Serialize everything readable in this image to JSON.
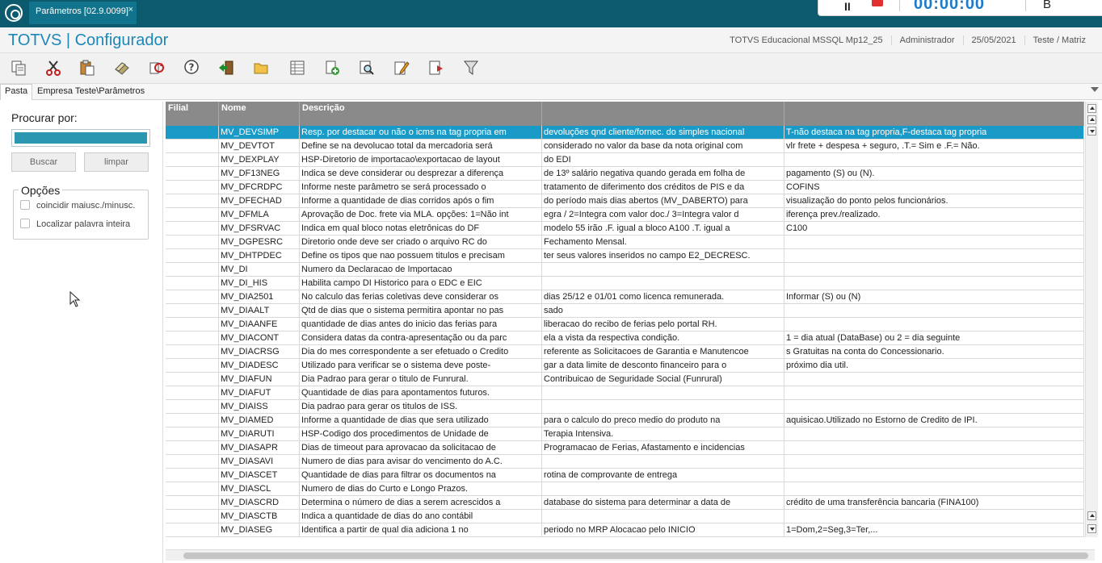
{
  "tab": {
    "title": "Parâmetros [02.9.0099]",
    "close": "×"
  },
  "timer": {
    "time": "00:00:00",
    "letter": "B",
    "pause": "II"
  },
  "app": {
    "title": "TOTVS | Configurador",
    "environment": "TOTVS Educacional MSSQL Mp12_25",
    "user": "Administrador",
    "date": "25/05/2021",
    "company": "Teste / Matriz"
  },
  "toolbar": {
    "icons": [
      "copy-icon",
      "cut-icon",
      "paste-icon",
      "erase-icon",
      "refresh-icon",
      "help-icon",
      "exit-icon",
      "folder-icon",
      "table-icon",
      "add-icon",
      "search-doc-icon",
      "edit-icon",
      "export-icon",
      "filter-icon"
    ]
  },
  "breadcrumb": {
    "tab": "Pasta",
    "path": "Empresa Teste\\Parâmetros"
  },
  "search": {
    "label": "Procurar por:",
    "value": "",
    "buscar": "Buscar",
    "limpar": "limpar",
    "options_title": "Opções",
    "opt_case": "coincidir maiusc./minusc.",
    "opt_word": "Localizar palavra inteira"
  },
  "grid": {
    "headers": [
      "Filial",
      "Nome",
      "Descrição",
      "",
      ""
    ],
    "rows": [
      [
        "",
        "MV_DEVSIMP",
        "Resp. por destacar ou não o icms na tag propria em",
        "devoluções qnd cliente/fornec. do simples nacional",
        "T-não destaca na tag propria,F-destaca tag propria"
      ],
      [
        "",
        "MV_DEVTOT",
        "Define se na devolucao total da mercadoria será",
        "considerado no valor da base da nota original com",
        "vlr frete + despesa + seguro, .T.= Sim e .F.= Não."
      ],
      [
        "",
        "MV_DEXPLAY",
        "HSP-Diretorio de importacao\\exportacao de layout",
        "do EDI",
        ""
      ],
      [
        "",
        "MV_DF13NEG",
        "Indica se deve considerar ou desprezar a diferença",
        "de 13º salário negativa quando gerada em folha de",
        "pagamento (S) ou (N)."
      ],
      [
        "",
        "MV_DFCRDPC",
        "Informe neste parâmetro se será processado o",
        "tratamento de diferimento dos créditos de PIS e da",
        "COFINS"
      ],
      [
        "",
        "MV_DFECHAD",
        "Informe a quantidade de dias corridos após o fim",
        "do período mais dias abertos (MV_DABERTO) para",
        "visualização do ponto pelos funcionários."
      ],
      [
        "",
        "MV_DFMLA",
        "Aprovação de Doc. frete via MLA. opções: 1=Não int",
        "egra / 2=Integra com valor doc./ 3=Integra valor d",
        "iferença prev./realizado."
      ],
      [
        "",
        "MV_DFSRVAC",
        "Indica em qual bloco notas eletrônicas do DF",
        "modelo 55 irão .F. igual a bloco A100 .T. igual a",
        "C100"
      ],
      [
        "",
        "MV_DGPESRC",
        "Diretorio onde deve ser criado o arquivo RC do",
        "Fechamento Mensal.",
        ""
      ],
      [
        "",
        "MV_DHTPDEC",
        "Define os tipos que nao possuem titulos e precisam",
        "ter seus valores inseridos no campo E2_DECRESC.",
        ""
      ],
      [
        "",
        "MV_DI",
        "Numero da Declaracao de Importacao",
        "",
        ""
      ],
      [
        "",
        "MV_DI_HIS",
        "Habilita campo DI Historico para o EDC e EIC",
        "",
        ""
      ],
      [
        "",
        "MV_DIA2501",
        "No calculo das ferias coletivas deve considerar os",
        "dias 25/12 e 01/01 como licenca remunerada.",
        "Informar (S) ou (N)"
      ],
      [
        "",
        "MV_DIAALT",
        "Qtd de dias que o sistema permitira apontar no pas",
        "sado",
        ""
      ],
      [
        "",
        "MV_DIAANFE",
        "quantidade de dias antes do inicio das ferias para",
        "liberacao do recibo de ferias pelo portal RH.",
        ""
      ],
      [
        "",
        "MV_DIACONT",
        "Considera datas da contra-apresentação ou da parc",
        "ela a vista da respectiva condição.",
        "1 = dia atual (DataBase) ou 2 = dia seguinte"
      ],
      [
        "",
        "MV_DIACRSG",
        "Dia do mes correspondente a ser efetuado o Credito",
        "referente as Solicitacoes de Garantia e Manutencoe",
        "s Gratuitas na conta do Concessionario."
      ],
      [
        "",
        "MV_DIADESC",
        "Utilizado para verificar se o sistema deve  poste-",
        "gar a data limite de desconto financeiro para o",
        "próximo dia util."
      ],
      [
        "",
        "MV_DIAFUN",
        "Dia Padrao para gerar o titulo de Funrural.",
        "Contribuicao de Seguridade Social (Funrural)",
        ""
      ],
      [
        "",
        "MV_DIAFUT",
        "Quantidade de dias para apontamentos futuros.",
        "",
        ""
      ],
      [
        "",
        "MV_DIAISS",
        "Dia padrao para gerar os titulos de  ISS.",
        "",
        ""
      ],
      [
        "",
        "MV_DIAMED",
        "Informe a quantidade de dias que sera utilizado",
        "para o calculo do preco medio do produto na",
        "aquisicao.Utilizado no Estorno de Credito de IPI."
      ],
      [
        "",
        "MV_DIARUTI",
        "HSP-Codigo dos procedimentos de Unidade de",
        "Terapia Intensiva.",
        ""
      ],
      [
        "",
        "MV_DIASAPR",
        "Dias de timeout para aprovacao da solicitacao de",
        "Programacao de Ferias, Afastamento e incidencias",
        ""
      ],
      [
        "",
        "MV_DIASAVI",
        "Numero de dias para avisar do vencimento do A.C.",
        "",
        ""
      ],
      [
        "",
        "MV_DIASCET",
        "Quantidade de dias para filtrar os documentos na",
        "rotina de comprovante de entrega",
        ""
      ],
      [
        "",
        "MV_DIASCL",
        "Numero de dias do Curto e Longo Prazos.",
        "",
        ""
      ],
      [
        "",
        "MV_DIASCRD",
        "Determina o número de dias a serem acrescidos a",
        "database do sistema para determinar a data de",
        "crédito de uma transferência bancaria (FINA100)"
      ],
      [
        "",
        "MV_DIASCTB",
        "Indica a quantidade de dias do ano contábil",
        "",
        ""
      ],
      [
        "",
        "MV_DIASEG",
        "Identifica a partir de qual dia adiciona 1 no",
        "periodo no MRP Alocacao pelo INICIO",
        "1=Dom,2=Seg,3=Ter,..."
      ]
    ]
  }
}
